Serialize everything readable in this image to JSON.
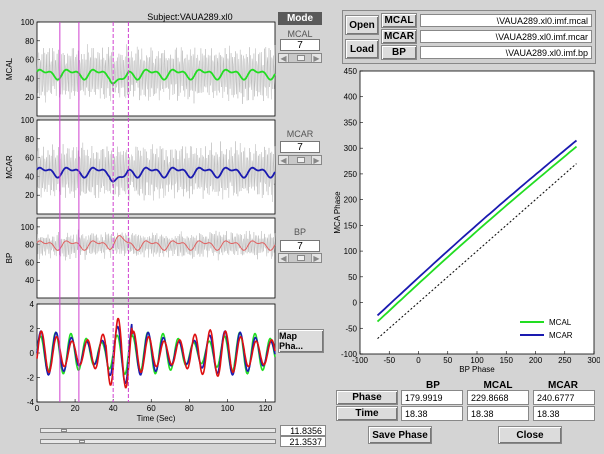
{
  "subject_title": "Subject:VAUA289.xl0",
  "mode_label": "Mode",
  "panels": [
    {
      "ylabel": "MCAL",
      "gui_title": "MCAL",
      "value": "7",
      "ticks": [
        "100",
        "80",
        "60",
        "40",
        "20"
      ]
    },
    {
      "ylabel": "MCAR",
      "gui_title": "MCAR",
      "value": "7",
      "ticks": [
        "100",
        "80",
        "60",
        "40",
        "20"
      ]
    },
    {
      "ylabel": "BP",
      "gui_title": "BP",
      "value": "7",
      "ticks": [
        "100",
        "80",
        "60",
        "40"
      ]
    },
    {
      "ylabel": "",
      "ticks": [
        "4",
        "2",
        "0",
        "-2",
        "-4"
      ]
    }
  ],
  "time_axis": {
    "label": "Time (Sec)",
    "ticks": [
      "0",
      "20",
      "40",
      "60",
      "80",
      "100",
      "120"
    ]
  },
  "map_phase_label": "Map Pha...",
  "sliders": {
    "value1": "11.8356",
    "value2": "21.3537"
  },
  "files": {
    "open_label": "Open",
    "load_label": "Load",
    "rows": [
      {
        "tag": "MCAL",
        "path": "\\VAUA289.xl0.imf.mcal"
      },
      {
        "tag": "MCAR",
        "path": "\\VAUA289.xl0.imf.mcar"
      },
      {
        "tag": "BP",
        "path": "\\VAUA289.xl0.imf.bp"
      }
    ]
  },
  "phase_plot": {
    "xlabel": "BP Phase",
    "ylabel": "MCA Phase",
    "xticks": [
      "-100",
      "-50",
      "0",
      "50",
      "100",
      "150",
      "200",
      "250",
      "300"
    ],
    "yticks": [
      "450",
      "400",
      "350",
      "300",
      "250",
      "200",
      "150",
      "100",
      "50",
      "0",
      "-50",
      "-100"
    ],
    "legend": [
      {
        "name": "MCAL",
        "color": "#22dd22"
      },
      {
        "name": "MCAR",
        "color": "#1a1ab0"
      }
    ]
  },
  "table": {
    "headers": [
      "BP",
      "MCAL",
      "MCAR"
    ],
    "rows": [
      {
        "label": "Phase",
        "values": [
          "179.9919",
          "229.8668",
          "240.6777"
        ]
      },
      {
        "label": "Time",
        "values": [
          "18.38",
          "18.38",
          "18.38"
        ]
      }
    ]
  },
  "buttons": {
    "save_phase": "Save Phase",
    "close": "Close"
  },
  "colors": {
    "mcal": "#22dd22",
    "mcar": "#1a1ab0",
    "bp": "#e06060",
    "imf_red": "#dd1111",
    "cursor": "#d040d0"
  }
}
